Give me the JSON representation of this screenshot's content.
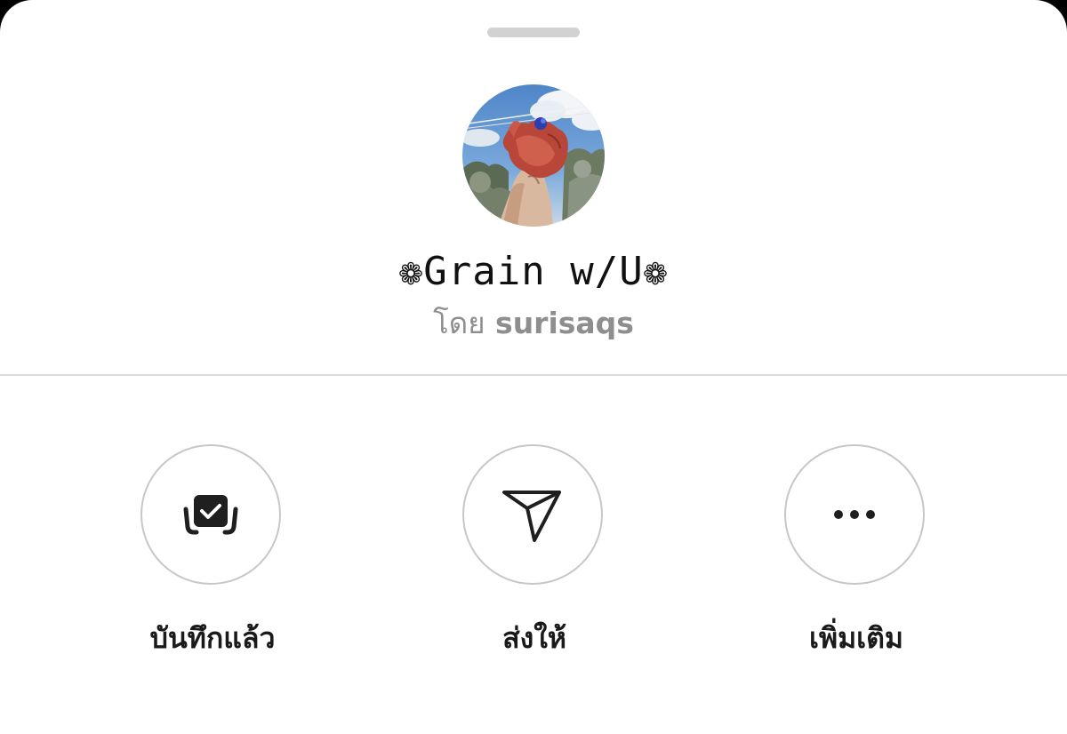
{
  "collection": {
    "title": "❁Grain w/U❁",
    "by_label": "โดย",
    "author": "surisaqs"
  },
  "actions": [
    {
      "label": "บันทึกแล้ว",
      "icon": "saved-collection-check-icon"
    },
    {
      "label": "ส่งให้",
      "icon": "send-paper-plane-icon"
    },
    {
      "label": "เพิ่มเติม",
      "icon": "more-ellipsis-icon"
    }
  ],
  "colors": {
    "sheet_background": "#ffffff",
    "secondary_text": "#8e8e8e",
    "primary_text": "#1a1a1a",
    "circle_border": "#c7c7c7"
  }
}
